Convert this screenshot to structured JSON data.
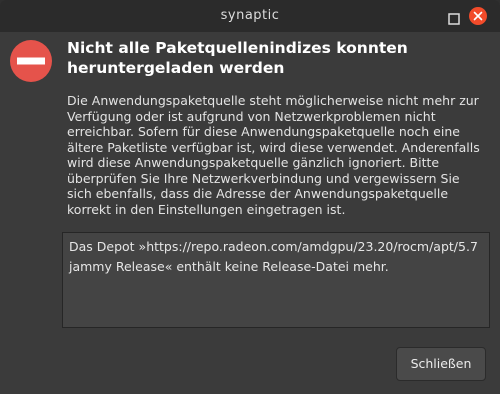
{
  "window": {
    "title": "synaptic"
  },
  "dialog": {
    "headline": "Nicht alle Paketquellenindizes konnten heruntergeladen werden",
    "body": "Die Anwendungspaketquelle steht möglicherweise nicht mehr zur Verfügung oder ist aufgrund von Netzwerkproblemen nicht erreichbar. Sofern für diese Anwendungspaketquelle noch eine ältere Paketliste verfügbar ist, wird diese verwendet. Anderenfalls wird diese Anwendungspaketquelle gänzlich ignoriert. Bitte überprüfen Sie Ihre Netzwerkverbindung und vergewissern Sie sich ebenfalls, dass die Adresse der Anwendungspaketquelle korrekt in den Einstellungen eingetragen ist.",
    "details": "Das Depot »https://repo.radeon.com/amdgpu/23.20/rocm/apt/5.7 jammy Release« enthält keine Release-Datei mehr.",
    "close_label": "Schließen"
  },
  "icons": {
    "dialog_icon": "stop-icon",
    "maximize": "maximize-icon",
    "close": "close-icon"
  },
  "colors": {
    "titlebar": "#2b2b2b",
    "background": "#3b3b3b",
    "stop_red": "#e5534b",
    "close_button_red": "#f24b2a"
  }
}
